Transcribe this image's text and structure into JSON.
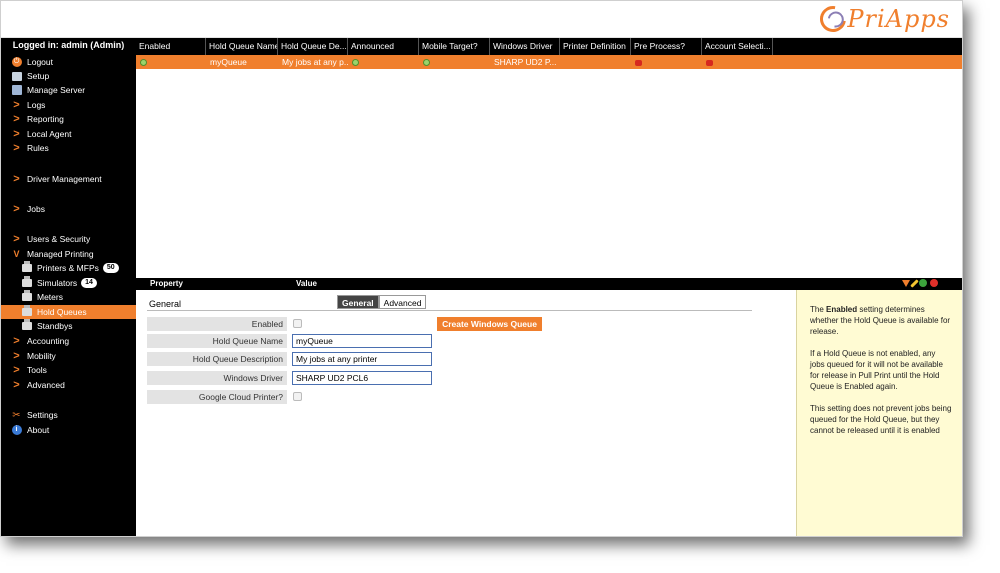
{
  "logo": {
    "text": "PriApps"
  },
  "sidebar": {
    "login_label": "Logged in: admin (Admin)",
    "items": [
      {
        "label": "Logout",
        "icon": "power-icon"
      },
      {
        "label": "Setup",
        "icon": "setup-icon"
      },
      {
        "label": "Manage Server",
        "icon": "manage-server-icon"
      },
      {
        "label": "Logs",
        "icon": "chevron-right-icon"
      },
      {
        "label": "Reporting",
        "icon": "chevron-right-icon"
      },
      {
        "label": "Local Agent",
        "icon": "chevron-right-icon"
      },
      {
        "label": "Rules",
        "icon": "chevron-right-icon"
      },
      {
        "label": "Driver Management",
        "icon": "chevron-right-icon"
      },
      {
        "label": "Jobs",
        "icon": "chevron-right-icon"
      },
      {
        "label": "Users & Security",
        "icon": "chevron-right-icon"
      },
      {
        "label": "Managed Printing",
        "icon": "chevron-down-icon"
      },
      {
        "label": "Printers & MFPs",
        "icon": "printer-icon",
        "badge": "50"
      },
      {
        "label": "Simulators",
        "icon": "printer-icon",
        "badge": "14"
      },
      {
        "label": "Meters",
        "icon": "printer-icon"
      },
      {
        "label": "Hold Queues",
        "icon": "printer-icon",
        "active": true
      },
      {
        "label": "Standbys",
        "icon": "printer-icon"
      },
      {
        "label": "Accounting",
        "icon": "chevron-right-icon"
      },
      {
        "label": "Mobility",
        "icon": "chevron-right-icon"
      },
      {
        "label": "Tools",
        "icon": "chevron-right-icon"
      },
      {
        "label": "Advanced",
        "icon": "chevron-right-icon"
      },
      {
        "label": "Settings",
        "icon": "settings-icon"
      },
      {
        "label": "About",
        "icon": "info-icon"
      }
    ]
  },
  "grid": {
    "columns": [
      "Enabled",
      "Hold Queue Name",
      "Hold Queue De...",
      "Announced",
      "Mobile Target?",
      "Windows Driver",
      "Printer Definition",
      "Pre Process?",
      "Account Selecti..."
    ],
    "rows": [
      {
        "enabled": "check",
        "name": "myQueue",
        "description": "My jobs at any p...",
        "announced": "check",
        "mobile": "check",
        "driver": "SHARP UD2 P...",
        "printer_def": "",
        "pre_process": "cross",
        "account": "cross"
      }
    ]
  },
  "property_bar": {
    "property_label": "Property",
    "value_label": "Value"
  },
  "form": {
    "section_title": "General",
    "tabs": [
      "General",
      "Advanced"
    ],
    "fields": {
      "enabled_label": "Enabled",
      "name_label": "Hold Queue Name",
      "name_value": "myQueue",
      "description_label": "Hold Queue Description",
      "description_value": "My jobs at any printer",
      "driver_label": "Windows Driver",
      "driver_value": "SHARP UD2 PCL6",
      "gcp_label": "Google Cloud Printer?"
    },
    "create_button": "Create Windows Queue"
  },
  "help": {
    "p1_pre": "The ",
    "p1_bold": "Enabled",
    "p1_post": " setting determines whether the Hold Queue is available for release.",
    "p2": "If a Hold Queue is not enabled, any jobs queued for it will not be available for release in Pull Print until the Hold Queue is Enabled again.",
    "p3": "This setting does not prevent jobs being queued for the Hold Queue, but they cannot be released until it is enabled"
  },
  "colors": {
    "accent": "#f07f2d",
    "sidebar_bg": "#000000",
    "help_bg": "#fffbd3"
  }
}
